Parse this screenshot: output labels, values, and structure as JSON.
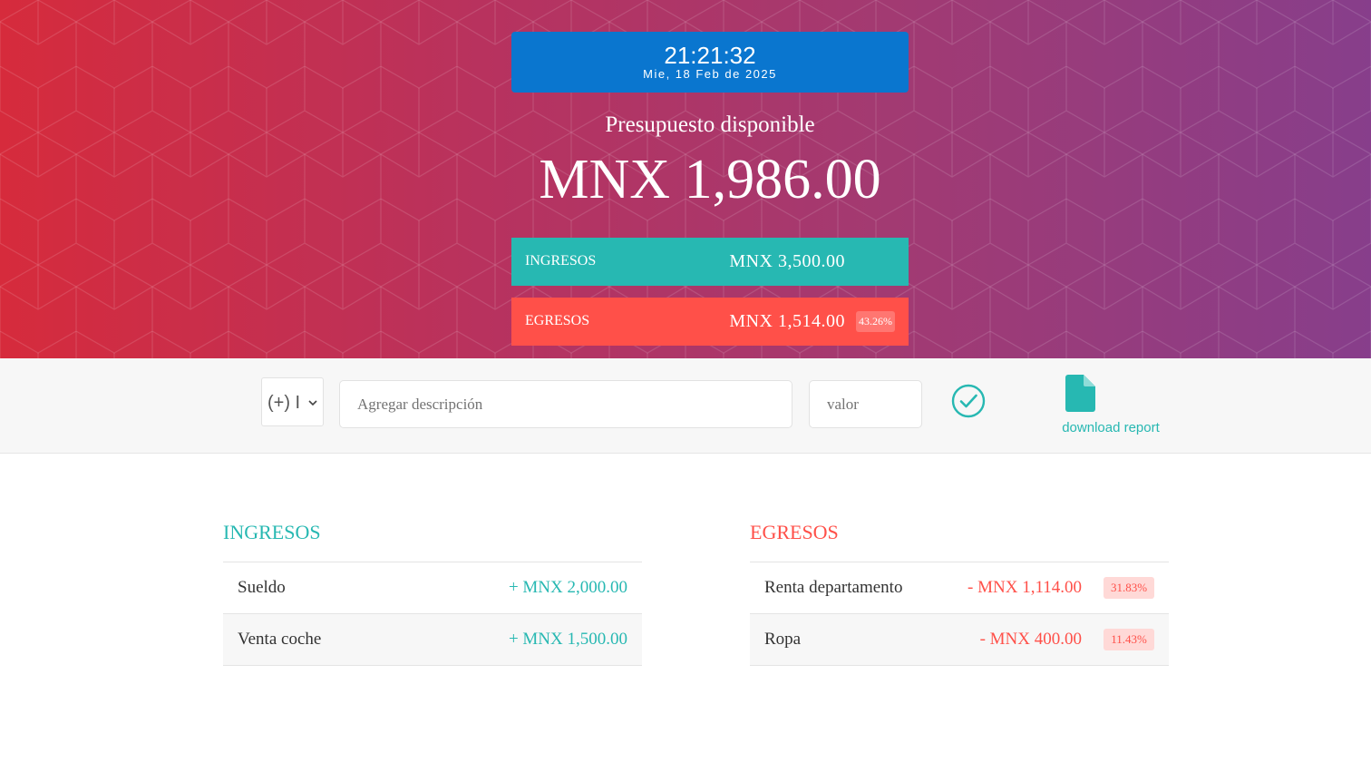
{
  "clock": {
    "time": "21:21:32",
    "date": "Mie, 18 Feb de 2025"
  },
  "budget": {
    "title": "Presupuesto disponible",
    "value": "MNX 1,986.00"
  },
  "summary": {
    "income": {
      "label": "INGRESOS",
      "value": "MNX 3,500.00"
    },
    "expense": {
      "label": "EGRESOS",
      "value": "MNX 1,514.00",
      "percentage": "43.26%"
    }
  },
  "add_form": {
    "type_selected": "(+) I",
    "description_placeholder": "Agregar descripción",
    "value_placeholder": "valor",
    "report_label": "download report"
  },
  "income_list": {
    "title": "INGRESOS",
    "items": [
      {
        "description": "Sueldo",
        "amount": "+ MNX 2,000.00"
      },
      {
        "description": "Venta coche",
        "amount": "+ MNX 1,500.00"
      }
    ]
  },
  "expense_list": {
    "title": "EGRESOS",
    "items": [
      {
        "description": "Renta departamento",
        "amount": "- MNX 1,114.00",
        "percentage": "31.83%"
      },
      {
        "description": "Ropa",
        "amount": "- MNX 400.00",
        "percentage": "11.43%"
      }
    ]
  },
  "colors": {
    "clock_bg": "#0a76cf",
    "income": "#27b8b2",
    "expense": "#ff5049",
    "hero_gradient_start": "#d62b3c",
    "hero_gradient_end": "#873e8b"
  }
}
